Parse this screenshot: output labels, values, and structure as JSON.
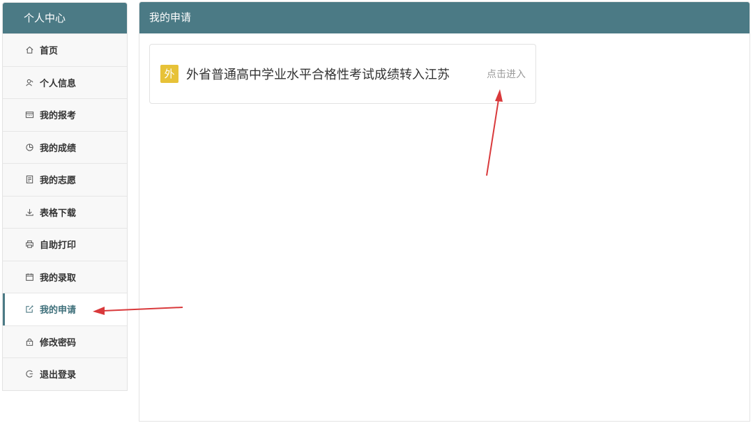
{
  "sidebar": {
    "title": "个人中心",
    "items": [
      {
        "label": "首页",
        "icon": "home-icon"
      },
      {
        "label": "个人信息",
        "icon": "user-icon"
      },
      {
        "label": "我的报考",
        "icon": "calendar-card-icon"
      },
      {
        "label": "我的成绩",
        "icon": "pie-chart-icon"
      },
      {
        "label": "我的志愿",
        "icon": "document-icon"
      },
      {
        "label": "表格下载",
        "icon": "download-icon"
      },
      {
        "label": "自助打印",
        "icon": "printer-icon"
      },
      {
        "label": "我的录取",
        "icon": "calendar-icon"
      },
      {
        "label": "我的申请",
        "icon": "edit-icon"
      },
      {
        "label": "修改密码",
        "icon": "lock-icon"
      },
      {
        "label": "退出登录",
        "icon": "logout-icon"
      }
    ],
    "active_index": 8
  },
  "main": {
    "title": "我的申请",
    "card": {
      "badge": "外",
      "title": "外省普通高中学业水平合格性考试成绩转入江苏",
      "link": "点击进入"
    }
  },
  "colors": {
    "header": "#4b7a85",
    "badge": "#e7c238",
    "annotation_arrow": "#d9393b"
  }
}
